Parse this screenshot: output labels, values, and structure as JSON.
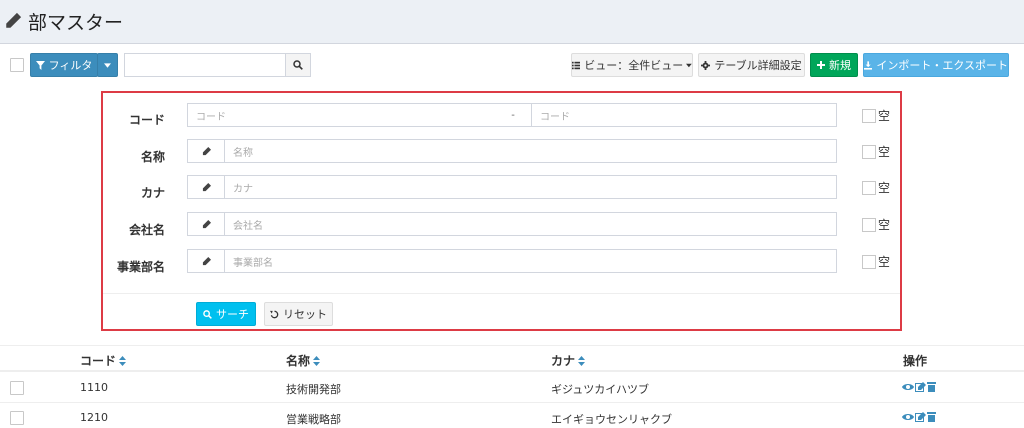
{
  "page": {
    "title": "部マスター"
  },
  "toolbar": {
    "filter_label": "フィルタ",
    "view_label": "ビュー：全件ビュー",
    "table_settings_label": "テーブル詳細設定",
    "new_label": "新規",
    "import_export_label": "インポート・エクスポート"
  },
  "filter": {
    "fields": [
      {
        "label": "コード",
        "placeholder_from": "コード",
        "range_sep": "-",
        "placeholder_to": "コード",
        "empty_label": "空"
      },
      {
        "label": "名称",
        "placeholder": "名称",
        "empty_label": "空"
      },
      {
        "label": "カナ",
        "placeholder": "カナ",
        "empty_label": "空"
      },
      {
        "label": "会社名",
        "placeholder": "会社名",
        "empty_label": "空"
      },
      {
        "label": "事業部名",
        "placeholder": "事業部名",
        "empty_label": "空"
      }
    ],
    "search_label": "サーチ",
    "reset_label": "リセット"
  },
  "table": {
    "columns": [
      "コード",
      "名称",
      "カナ",
      "操作"
    ],
    "rows": [
      {
        "code": "1110",
        "name": "技術開発部",
        "kana": "ギジュツカイハツブ"
      },
      {
        "code": "1210",
        "name": "営業戦略部",
        "kana": "エイギョウセンリャクブ"
      }
    ]
  },
  "colors": {
    "primary": "#3c8dbc",
    "success": "#00a65a",
    "info": "#5ab4e8",
    "cyan": "#00c0ef",
    "highlight": "#dd3b45"
  }
}
